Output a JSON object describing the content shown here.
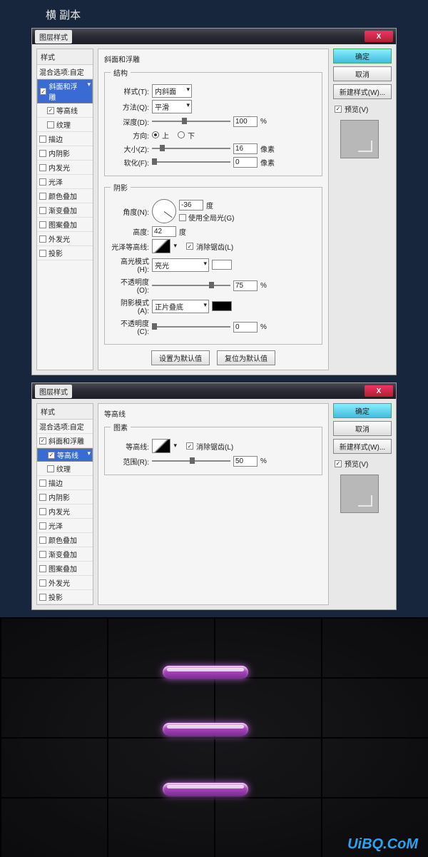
{
  "page_title": "横 副本",
  "dialog_title": "图层样式",
  "close_x": "X",
  "styles": {
    "header": "样式",
    "blend": "混合选项:自定",
    "bevel": "斜面和浮雕",
    "contour": "等高线",
    "texture": "纹理",
    "stroke": "描边",
    "inner_shadow": "内阴影",
    "inner_glow": "内发光",
    "satin": "光泽",
    "color_overlay": "颜色叠加",
    "gradient_overlay": "渐变叠加",
    "pattern_overlay": "图案叠加",
    "outer_glow": "外发光",
    "drop_shadow": "投影"
  },
  "bevel": {
    "section": "斜面和浮雕",
    "struct": "结构",
    "style_l": "样式(T):",
    "style_v": "内斜面",
    "tech_l": "方法(Q):",
    "tech_v": "平滑",
    "depth_l": "深度(D):",
    "depth_v": "100",
    "depth_u": "%",
    "dir_l": "方向:",
    "dir_up": "上",
    "dir_down": "下",
    "size_l": "大小(Z):",
    "size_v": "16",
    "size_u": "像素",
    "soft_l": "软化(F):",
    "soft_v": "0",
    "soft_u": "像素",
    "shade": "阴影",
    "angle_l": "角度(N):",
    "angle_v": "-36",
    "angle_u": "度",
    "global": "使用全局光(G)",
    "alt_l": "高度:",
    "alt_v": "42",
    "alt_u": "度",
    "gloss_l": "光泽等高线:",
    "anti": "消除锯齿(L)",
    "hi_mode_l": "高光模式(H):",
    "hi_mode_v": "亮光",
    "hi_op_l": "不透明度(O):",
    "hi_op_v": "75",
    "op_u": "%",
    "sh_mode_l": "阴影模式(A):",
    "sh_mode_v": "正片叠底",
    "sh_op_l": "不透明度(C):",
    "sh_op_v": "0",
    "btn_def": "设置为默认值",
    "btn_reset": "复位为默认值"
  },
  "cont": {
    "section": "等高线",
    "group": "图素",
    "contour_l": "等高线:",
    "anti": "消除锯齿(L)",
    "range_l": "范围(R):",
    "range_v": "50",
    "range_u": "%"
  },
  "side": {
    "ok": "确定",
    "cancel": "取消",
    "new_style": "新建样式(W)...",
    "preview": "预览(V)"
  },
  "watermark": "UiBQ.CoM"
}
